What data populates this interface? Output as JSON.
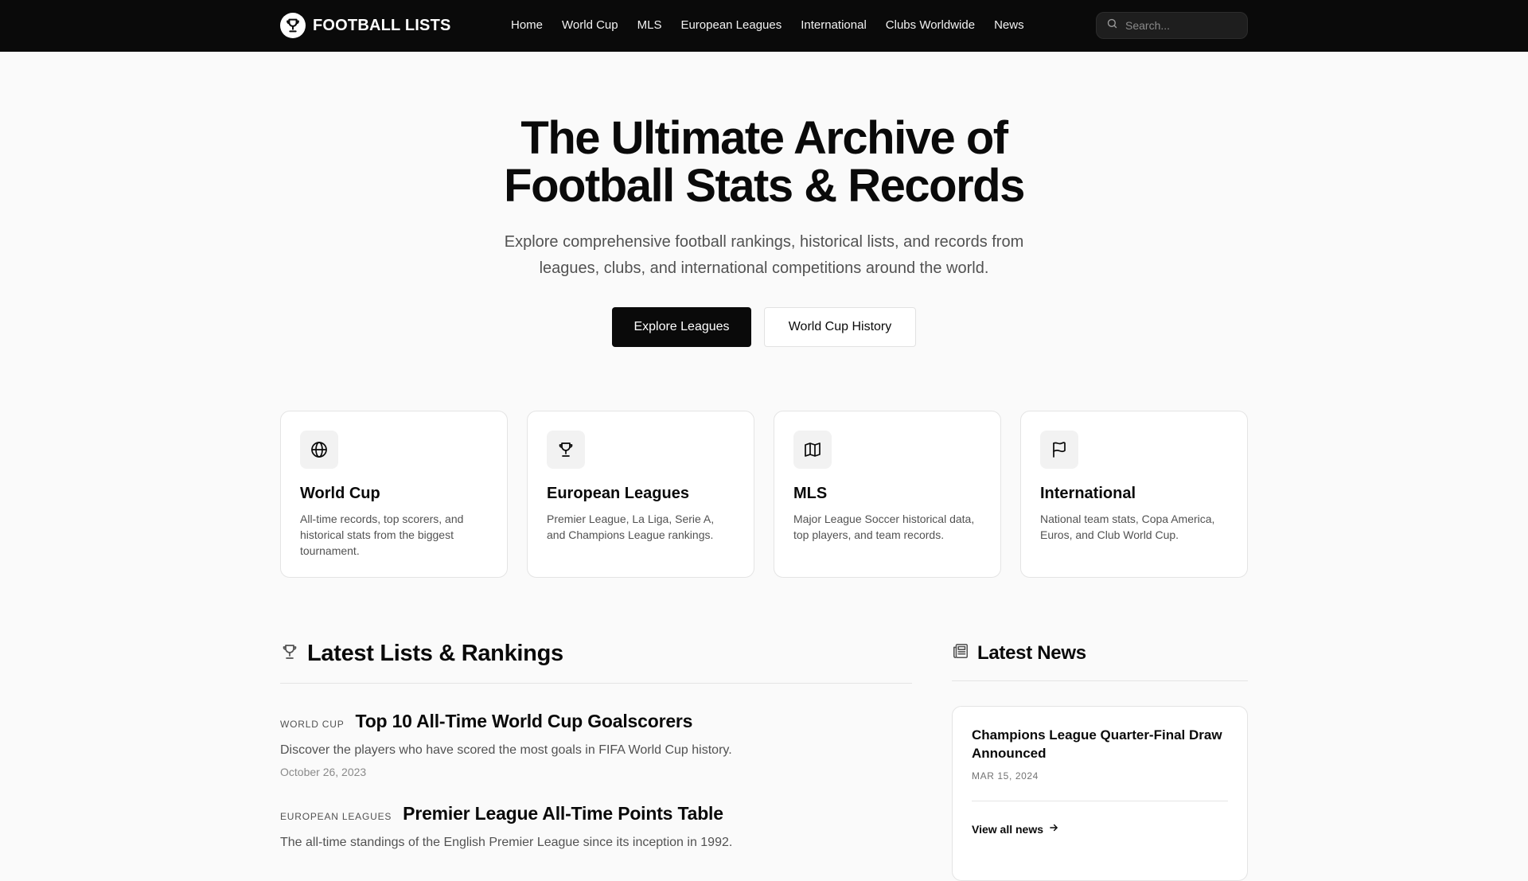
{
  "header": {
    "brand": "FOOTBALL LISTS",
    "nav": [
      "Home",
      "World Cup",
      "MLS",
      "European Leagues",
      "International",
      "Clubs Worldwide",
      "News"
    ],
    "search_placeholder": "Search..."
  },
  "hero": {
    "title_line1": "The Ultimate Archive of",
    "title_line2": "Football Stats & Records",
    "subtitle_line1": "Explore comprehensive football rankings, historical lists, and records from",
    "subtitle_line2": "leagues, clubs, and international competitions around the world.",
    "primary_cta": "Explore Leagues",
    "secondary_cta": "World Cup History"
  },
  "categories": [
    {
      "title": "World Cup",
      "icon": "globe-icon",
      "desc": "All-time records, top scorers, and historical stats from the biggest tournament."
    },
    {
      "title": "European Leagues",
      "icon": "trophy-icon",
      "desc": "Premier League, La Liga, Serie A, and Champions League rankings."
    },
    {
      "title": "MLS",
      "icon": "map-icon",
      "desc": "Major League Soccer historical data, top players, and team records."
    },
    {
      "title": "International",
      "icon": "flag-icon",
      "desc": "National team stats, Copa America, Euros, and Club World Cup."
    }
  ],
  "lists": {
    "heading": "Latest Lists & Rankings",
    "items": [
      {
        "category": "WORLD CUP",
        "title": "Top 10 All-Time World Cup Goalscorers",
        "desc": "Discover the players who have scored the most goals in FIFA World Cup history.",
        "date": "October 26, 2023"
      },
      {
        "category": "EUROPEAN LEAGUES",
        "title": "Premier League All-Time Points Table",
        "desc": "The all-time standings of the English Premier League since its inception in 1992."
      }
    ]
  },
  "news": {
    "heading": "Latest News",
    "items": [
      {
        "title": "Champions League Quarter-Final Draw Announced",
        "date": "MAR 15, 2024"
      }
    ],
    "view_all": "View all news"
  }
}
